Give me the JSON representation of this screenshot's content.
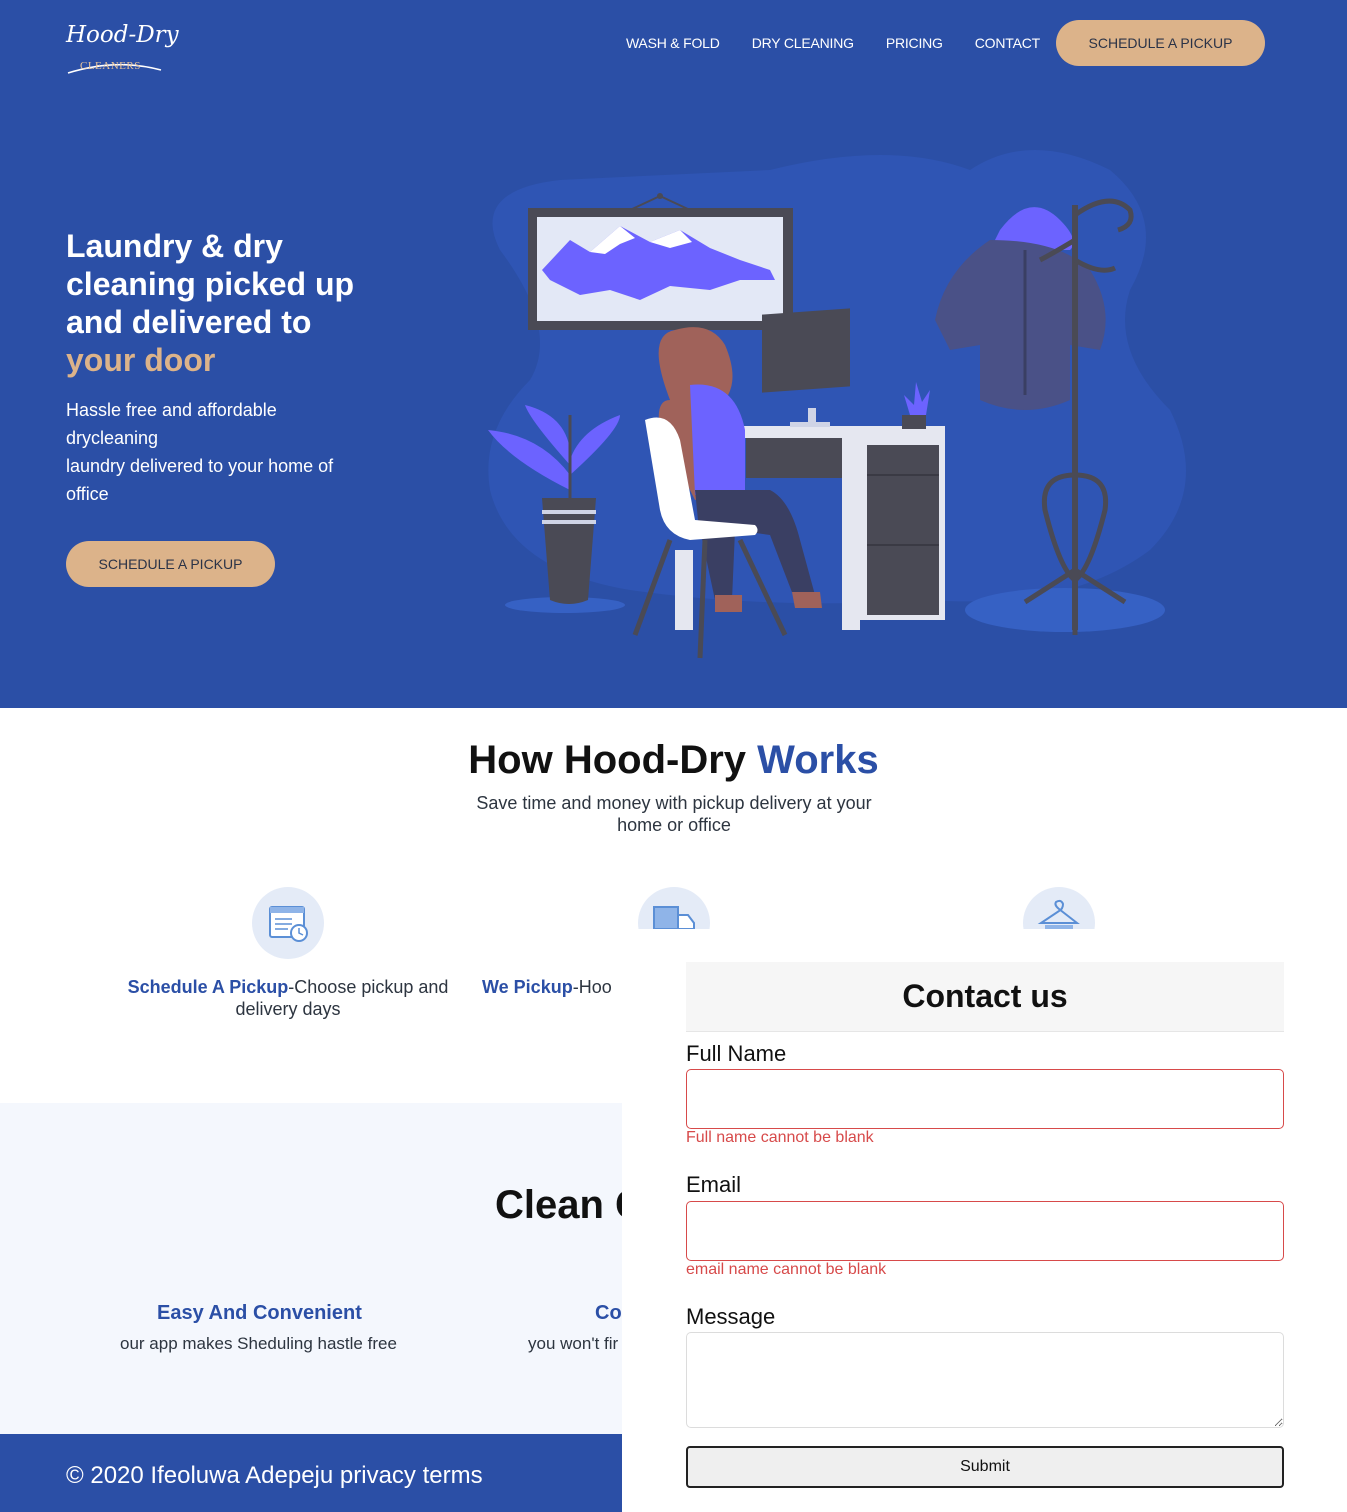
{
  "brand": {
    "name": "Hood-Dry",
    "sub": "CLEANERS"
  },
  "nav": {
    "links": [
      "WASH & FOLD",
      "DRY CLEANING",
      "PRICING",
      "CONTACT"
    ],
    "cta": "SCHEDULE A PICKUP"
  },
  "hero": {
    "title": "Laundry & dry cleaning picked up and delivered to",
    "title_accent": "your door",
    "subtitle_lines": [
      "Hassle free and affordable",
      "drycleaning",
      "laundry delivered to your home of",
      "office"
    ],
    "cta": "SCHEDULE A PICKUP",
    "illustration": "woman-at-desk-illustration"
  },
  "how": {
    "title_main": "How Hood-Dry ",
    "title_accent": "Works",
    "subtitle": "Save time and money with pickup delivery at your home or office",
    "steps": [
      {
        "icon": "calendar-clock-icon",
        "title": "Schedule A Pickup",
        "text": "-Choose pickup and delivery days"
      },
      {
        "icon": "delivery-truck-icon",
        "title": "We Pickup",
        "text": "-Hoo"
      },
      {
        "icon": "hanger-icon"
      }
    ]
  },
  "clean": {
    "title": "Clean C",
    "features": [
      {
        "title": "Easy And Convenient",
        "text": "our app makes Sheduling hastle free"
      },
      {
        "title": "Co",
        "text": "you won't fir"
      }
    ]
  },
  "footer": {
    "text": "© 2020 Ifeoluwa Adepeju privacy terms"
  },
  "contact": {
    "title": "Contact us",
    "fields": {
      "name_label": "Full Name",
      "name_value": "",
      "name_error": "Full name cannot be blank",
      "email_label": "Email",
      "email_value": "",
      "email_error": "email name cannot be blank",
      "message_label": "Message",
      "message_value": ""
    },
    "submit": "Submit"
  },
  "colors": {
    "primary": "#2b4fa6",
    "accent": "#dcb38a",
    "error": "#d74a4a",
    "illustration_purple": "#6c63ff",
    "section_bg": "#f4f7fd"
  }
}
